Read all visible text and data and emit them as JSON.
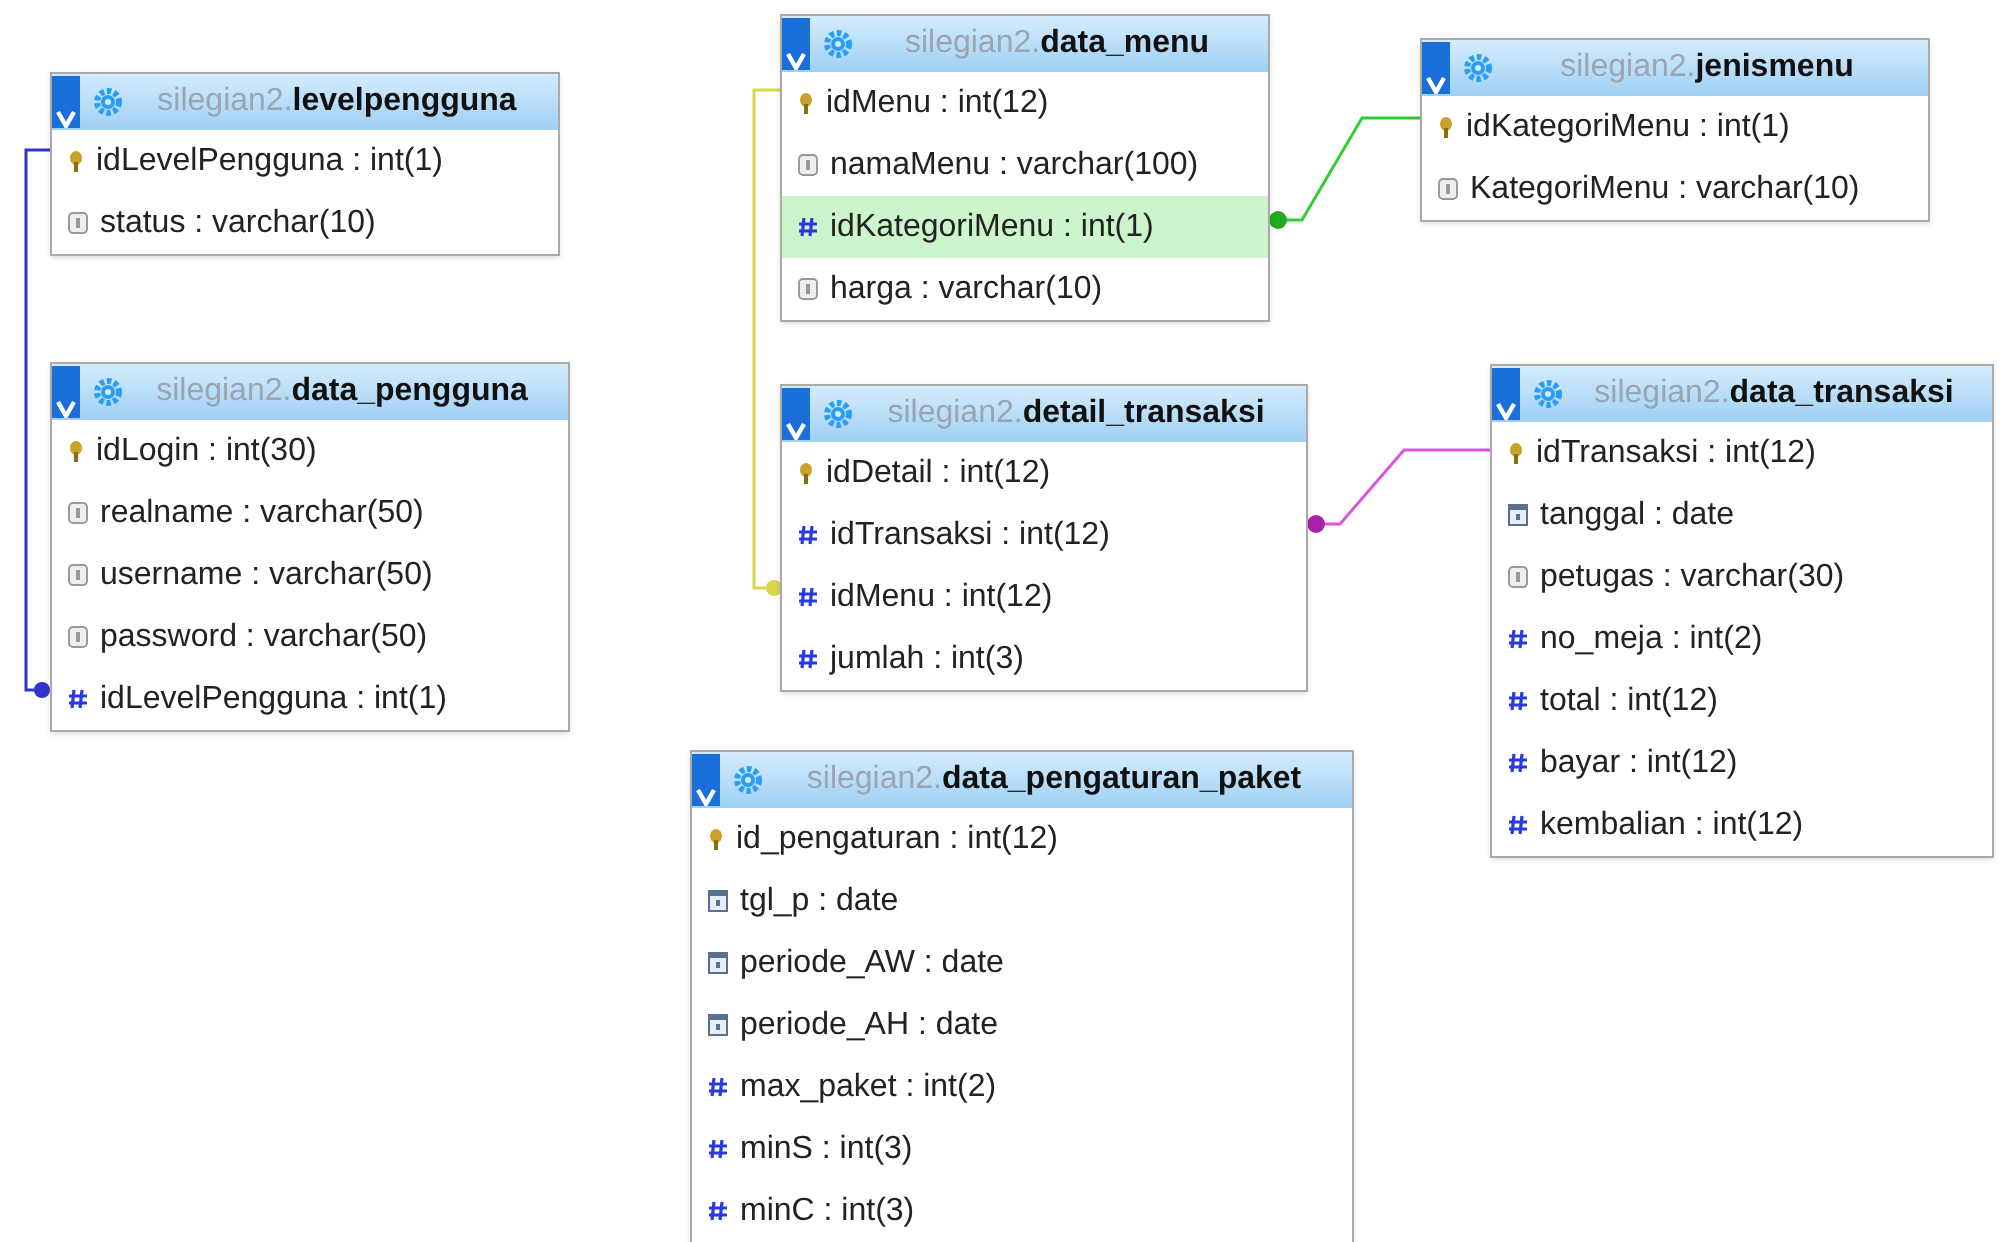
{
  "tables": [
    {
      "schema": "silegian2.",
      "name": "levelpengguna",
      "columns": [
        {
          "kind": "key",
          "label": "idLevelPengguna : int(1)",
          "highlighted": false
        },
        {
          "kind": "text",
          "label": "status : varchar(10)",
          "highlighted": false
        }
      ]
    },
    {
      "schema": "silegian2.",
      "name": "data_pengguna",
      "columns": [
        {
          "kind": "key",
          "label": "idLogin : int(30)",
          "highlighted": false
        },
        {
          "kind": "text",
          "label": "realname : varchar(50)",
          "highlighted": false
        },
        {
          "kind": "text",
          "label": "username : varchar(50)",
          "highlighted": false
        },
        {
          "kind": "text",
          "label": "password : varchar(50)",
          "highlighted": false
        },
        {
          "kind": "number",
          "label": "idLevelPengguna : int(1)",
          "highlighted": false
        }
      ]
    },
    {
      "schema": "silegian2.",
      "name": "data_menu",
      "columns": [
        {
          "kind": "key",
          "label": "idMenu : int(12)",
          "highlighted": false
        },
        {
          "kind": "text",
          "label": "namaMenu : varchar(100)",
          "highlighted": false
        },
        {
          "kind": "number",
          "label": "idKategoriMenu : int(1)",
          "highlighted": true
        },
        {
          "kind": "text",
          "label": "harga : varchar(10)",
          "highlighted": false
        }
      ]
    },
    {
      "schema": "silegian2.",
      "name": "jenismenu",
      "columns": [
        {
          "kind": "key",
          "label": "idKategoriMenu : int(1)",
          "highlighted": false
        },
        {
          "kind": "text",
          "label": "KategoriMenu : varchar(10)",
          "highlighted": false
        }
      ]
    },
    {
      "schema": "silegian2.",
      "name": "detail_transaksi",
      "columns": [
        {
          "kind": "key",
          "label": "idDetail : int(12)",
          "highlighted": false
        },
        {
          "kind": "number",
          "label": "idTransaksi : int(12)",
          "highlighted": false
        },
        {
          "kind": "number",
          "label": "idMenu : int(12)",
          "highlighted": false
        },
        {
          "kind": "number",
          "label": "jumlah : int(3)",
          "highlighted": false
        }
      ]
    },
    {
      "schema": "silegian2.",
      "name": "data_transaksi",
      "columns": [
        {
          "kind": "key",
          "label": "idTransaksi : int(12)",
          "highlighted": false
        },
        {
          "kind": "date",
          "label": "tanggal : date",
          "highlighted": false
        },
        {
          "kind": "text",
          "label": "petugas : varchar(30)",
          "highlighted": false
        },
        {
          "kind": "number",
          "label": "no_meja : int(2)",
          "highlighted": false
        },
        {
          "kind": "number",
          "label": "total : int(12)",
          "highlighted": false
        },
        {
          "kind": "number",
          "label": "bayar : int(12)",
          "highlighted": false
        },
        {
          "kind": "number",
          "label": "kembalian : int(12)",
          "highlighted": false
        }
      ]
    },
    {
      "schema": "silegian2.",
      "name": "data_pengaturan_paket",
      "columns": [
        {
          "kind": "key",
          "label": "id_pengaturan : int(12)",
          "highlighted": false
        },
        {
          "kind": "date",
          "label": "tgl_p : date",
          "highlighted": false
        },
        {
          "kind": "date",
          "label": "periode_AW : date",
          "highlighted": false
        },
        {
          "kind": "date",
          "label": "periode_AH : date",
          "highlighted": false
        },
        {
          "kind": "number",
          "label": "max_paket : int(2)",
          "highlighted": false
        },
        {
          "kind": "number",
          "label": "minS : int(3)",
          "highlighted": false
        },
        {
          "kind": "number",
          "label": "minC : int(3)",
          "highlighted": false
        }
      ]
    }
  ]
}
